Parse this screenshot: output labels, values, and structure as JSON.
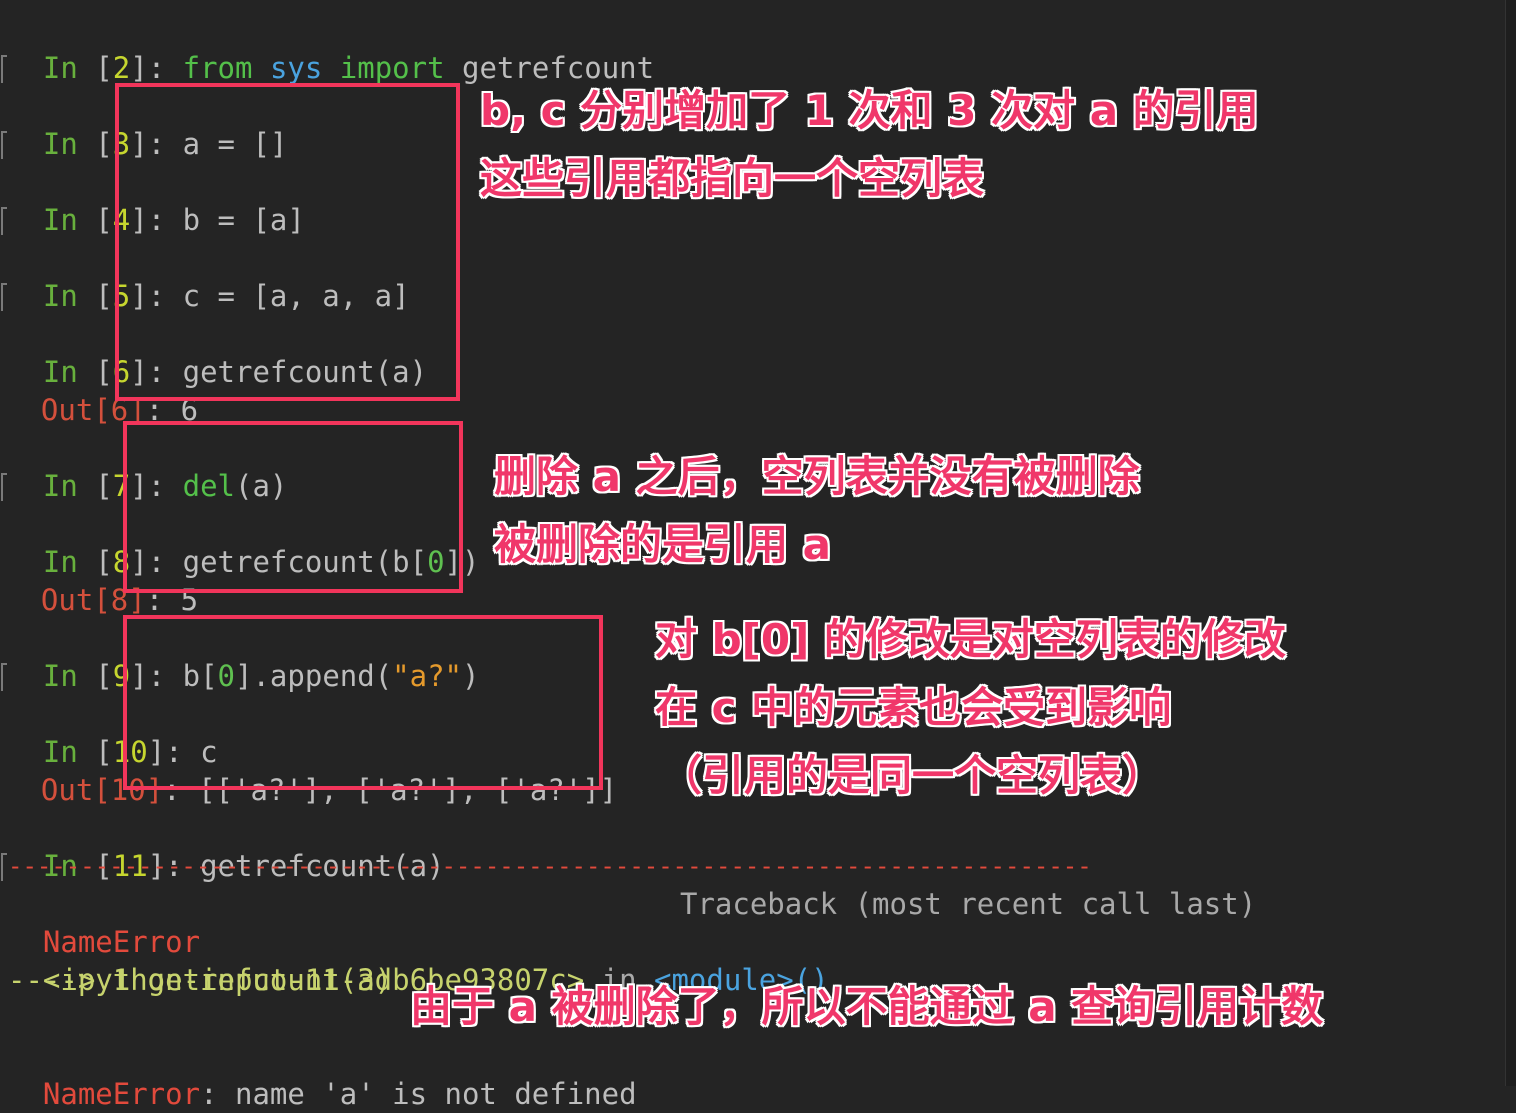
{
  "prompts": {
    "in_label": "In",
    "out_label": "Out"
  },
  "lines": {
    "l2": {
      "num": "2",
      "code_kw1": "from",
      "code_mod": "sys",
      "code_kw2": "import",
      "code_rest": "getrefcount"
    },
    "l3": {
      "num": "3",
      "code": "a = []"
    },
    "l4": {
      "num": "4",
      "code": "b = [a]"
    },
    "l5": {
      "num": "5",
      "code": "c = [a, a, a]"
    },
    "l6": {
      "num": "6",
      "code": "getrefcount(a)",
      "out": "6"
    },
    "l7": {
      "num": "7",
      "code_kw": "del",
      "code_rest": "(a)"
    },
    "l8": {
      "num": "8",
      "code_pre": "getrefcount(b[",
      "code_num": "0",
      "code_post": "])",
      "out": "5"
    },
    "l9": {
      "num": "9",
      "code_pre": "b[",
      "code_num": "0",
      "code_mid": "].append(",
      "code_str": "\"a?\"",
      "code_post": ")"
    },
    "l10": {
      "num": "10",
      "code": "c",
      "out": "[['a?'], ['a?'], ['a?']]"
    },
    "l11": {
      "num": "11",
      "code": "getrefcount(a)"
    }
  },
  "traceback": {
    "dashes": "---------------------------------------------------------------------------",
    "error_name": "NameError",
    "header_right": "Traceback (most recent call last)",
    "location_file": "<ipython-input-11-3db6be93807c>",
    "location_in": " in ",
    "location_module": "<module>()",
    "arrow_line": "----> 1 getrefcount(a)",
    "final_name": "NameError",
    "final_msg": ": name 'a' is not defined"
  },
  "annotations": {
    "note1_line1": "b, c 分别增加了 1 次和 3 次对 a 的引用",
    "note1_line2": "这些引用都指向一个空列表",
    "note2_line1": "删除 a 之后，空列表并没有被删除",
    "note2_line2": "被删除的是引用 a",
    "note3_line1": "对 b[0] 的修改是对空列表的修改",
    "note3_line2": "在 c 中的元素也会受到影响",
    "note3_line3": "（引用的是同一个空列表）",
    "note4": "由于 a 被删除了，所以不能通过 a 查询引用计数"
  },
  "colors": {
    "background": "#242424",
    "annotation": "#f0376a",
    "box_border": "#f2355b"
  }
}
